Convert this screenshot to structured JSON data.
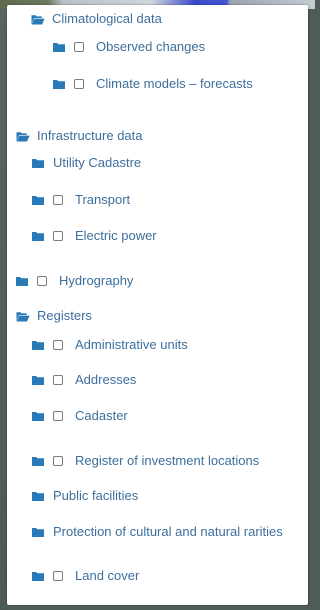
{
  "colors": {
    "accent": "#2a7ab8",
    "text": "#3d6f9c",
    "panel_background": "#ffffff"
  },
  "tree": {
    "climatological": {
      "label": "Climatological data",
      "icon": "folder-open-icon",
      "children": [
        {
          "label": "Observed changes",
          "icon": "folder-icon",
          "checkbox": true,
          "checked": false
        },
        {
          "label": "Climate models – forecasts",
          "icon": "folder-icon",
          "checkbox": true,
          "checked": false
        }
      ]
    },
    "infrastructure": {
      "label": "Infrastructure data",
      "icon": "folder-open-icon",
      "children": [
        {
          "label": "Utility Cadastre",
          "icon": "folder-icon",
          "checkbox": false
        },
        {
          "label": "Transport",
          "icon": "folder-icon",
          "checkbox": true,
          "checked": false
        },
        {
          "label": "Electric power",
          "icon": "folder-icon",
          "checkbox": true,
          "checked": false
        }
      ]
    },
    "hydrography": {
      "label": "Hydrography",
      "icon": "folder-icon",
      "checkbox": true,
      "checked": false
    },
    "registers": {
      "label": "Registers",
      "icon": "folder-open-icon",
      "children": [
        {
          "label": "Administrative units",
          "icon": "folder-icon",
          "checkbox": true,
          "checked": false
        },
        {
          "label": "Addresses",
          "icon": "folder-icon",
          "checkbox": true,
          "checked": false
        },
        {
          "label": "Cadaster",
          "icon": "folder-icon",
          "checkbox": true,
          "checked": false
        },
        {
          "label": "Register of investment locations",
          "icon": "folder-icon",
          "checkbox": true,
          "checked": false
        },
        {
          "label": "Public facilities",
          "icon": "folder-icon",
          "checkbox": false
        },
        {
          "label": "Protection of cultural and natural rarities",
          "icon": "folder-icon",
          "checkbox": false
        },
        {
          "label": "Land cover",
          "icon": "folder-icon",
          "checkbox": true,
          "checked": false
        }
      ]
    }
  }
}
